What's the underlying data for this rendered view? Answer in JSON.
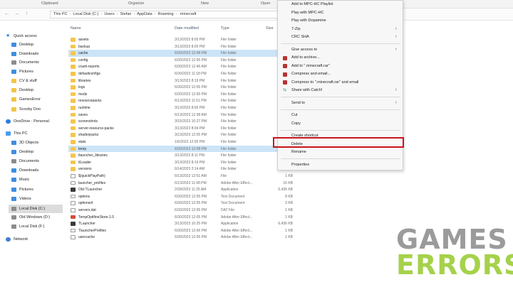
{
  "ribbon": {
    "tabs": [
      "Clipboard",
      "Organize",
      "New",
      "Open"
    ]
  },
  "address": {
    "segments": [
      "This PC",
      "Local Disk (C:)",
      "Users",
      "Stefan",
      "AppData",
      "Roaming",
      ".minecraft"
    ]
  },
  "sidebar": {
    "items": [
      {
        "label": "Quick access",
        "icon": "star-icon",
        "kind": "star"
      },
      {
        "label": "Desktop",
        "icon": "desktop-icon",
        "kind": "blue"
      },
      {
        "label": "Downloads",
        "icon": "downloads-icon",
        "kind": "blue"
      },
      {
        "label": "Documents",
        "icon": "documents-icon",
        "kind": "gray"
      },
      {
        "label": "Pictures",
        "icon": "pictures-icon",
        "kind": "blue"
      },
      {
        "label": "CV & stuff",
        "icon": "folder-icon",
        "kind": "yellow"
      },
      {
        "label": "Desktop",
        "icon": "folder-icon",
        "kind": "yellow"
      },
      {
        "label": "GamesError",
        "icon": "folder-icon",
        "kind": "yellow"
      },
      {
        "label": "Scooby Doo",
        "icon": "folder-icon",
        "kind": "yellow"
      },
      {
        "label": "OneDrive - Personal",
        "icon": "cloud-icon",
        "kind": "cloud"
      },
      {
        "label": "This PC",
        "icon": "computer-icon",
        "kind": "pc"
      },
      {
        "label": "3D Objects",
        "icon": "cube-icon",
        "kind": "blue"
      },
      {
        "label": "Desktop",
        "icon": "desktop-icon",
        "kind": "blue"
      },
      {
        "label": "Documents",
        "icon": "documents-icon",
        "kind": "gray"
      },
      {
        "label": "Downloads",
        "icon": "downloads-icon",
        "kind": "blue"
      },
      {
        "label": "Music",
        "icon": "music-icon",
        "kind": "blue"
      },
      {
        "label": "Pictures",
        "icon": "pictures-icon",
        "kind": "blue"
      },
      {
        "label": "Videos",
        "icon": "videos-icon",
        "kind": "blue"
      },
      {
        "label": "Local Disk (C:)",
        "icon": "drive-icon",
        "kind": "gray"
      },
      {
        "label": "Old Windows (D:)",
        "icon": "drive-icon",
        "kind": "gray"
      },
      {
        "label": "Local Disk (F:)",
        "icon": "drive-icon",
        "kind": "gray"
      },
      {
        "label": "Network",
        "icon": "network-icon",
        "kind": "net"
      }
    ],
    "selected_index": 18
  },
  "list": {
    "headers": {
      "name": "Name",
      "date": "Date modified",
      "type": "Type",
      "size": "Size"
    },
    "rows": [
      {
        "name": "assets",
        "date": "3/13/2023 8:05 PM",
        "type": "File folder",
        "size": "",
        "kind": "folder"
      },
      {
        "name": "backup",
        "date": "3/13/2023 8:05 PM",
        "type": "File folder",
        "size": "",
        "kind": "folder"
      },
      {
        "name": "cache",
        "date": "6/30/2023 12:08 PM",
        "type": "File folder",
        "size": "",
        "kind": "folder",
        "highlight": true
      },
      {
        "name": "config",
        "date": "6/30/2023 12:05 PM",
        "type": "File folder",
        "size": "",
        "kind": "folder"
      },
      {
        "name": "crash-reports",
        "date": "6/30/2023 12:46 AM",
        "type": "File folder",
        "size": "",
        "kind": "folder"
      },
      {
        "name": "defaultconfigs",
        "date": "6/30/2023 11:18 PM",
        "type": "File folder",
        "size": "",
        "kind": "folder"
      },
      {
        "name": "libraries",
        "date": "3/13/2023 8:19 PM",
        "type": "File folder",
        "size": "",
        "kind": "folder"
      },
      {
        "name": "logs",
        "date": "6/30/2023 12:05 PM",
        "type": "File folder",
        "size": "",
        "kind": "folder"
      },
      {
        "name": "mods",
        "date": "6/30/2023 12:05 PM",
        "type": "File folder",
        "size": "",
        "kind": "folder"
      },
      {
        "name": "resourcepacks",
        "date": "6/13/2023 11:51 PM",
        "type": "File folder",
        "size": "",
        "kind": "folder"
      },
      {
        "name": "runtime",
        "date": "3/13/2023 8:06 PM",
        "type": "File folder",
        "size": "",
        "kind": "folder"
      },
      {
        "name": "saves",
        "date": "6/13/2023 12:38 AM",
        "type": "File folder",
        "size": "",
        "kind": "folder"
      },
      {
        "name": "screenshots",
        "date": "3/15/2023 10:27 PM",
        "type": "File folder",
        "size": "",
        "kind": "folder"
      },
      {
        "name": "server-resource-packs",
        "date": "3/13/2023 8:04 PM",
        "type": "File folder",
        "size": "",
        "kind": "folder"
      },
      {
        "name": "shaderpacks",
        "date": "3/13/2023 12:05 PM",
        "type": "File folder",
        "size": "",
        "kind": "folder"
      },
      {
        "name": "stats",
        "date": "1/6/2023 12:05 PM",
        "type": "File folder",
        "size": "",
        "kind": "folder"
      },
      {
        "name": "temp",
        "date": "6/30/2023 12:08 PM",
        "type": "File folder",
        "size": "",
        "kind": "folder",
        "highlight": true
      },
      {
        "name": "tlauncher_libraries",
        "date": "3/13/2023 8:11 PM",
        "type": "File folder",
        "size": "",
        "kind": "folder"
      },
      {
        "name": "tlLoader",
        "date": "3/13/2023 8:19 PM",
        "type": "File folder",
        "size": "",
        "kind": "folder"
      },
      {
        "name": "versions",
        "date": "6/14/2023 2:14 AM",
        "type": "File folder",
        "size": "",
        "kind": "folder"
      },
      {
        "name": "$(quickPlayPath)",
        "date": "6/13/2023 12:51 AM",
        "type": "File",
        "size": "1 KB",
        "kind": "file"
      },
      {
        "name": "launcher_profiles",
        "date": "6/13/2023 11:08 PM",
        "type": "Adobe After Effect...",
        "size": "16 KB",
        "kind": "file"
      },
      {
        "name": "Old-TLauncher",
        "date": "2/28/2023 11:25 AM",
        "type": "Application",
        "size": "6,436 KB",
        "kind": "app"
      },
      {
        "name": "options",
        "date": "6/30/2023 12:05 PM",
        "type": "Text Document",
        "size": "8 KB",
        "kind": "file"
      },
      {
        "name": "optionsof",
        "date": "6/30/2023 12:05 PM",
        "type": "Text Document",
        "size": "3 KB",
        "kind": "file"
      },
      {
        "name": "servers.dat",
        "date": "6/30/2023 12:05 PM",
        "type": "DAT File",
        "size": "1 KB",
        "kind": "file"
      },
      {
        "name": "TempOptifineStore-1.0",
        "date": "6/30/2023 12:05 PM",
        "type": "Adobe After Effect...",
        "size": "1 KB",
        "kind": "pdf"
      },
      {
        "name": "TLauncher",
        "date": "3/13/2023 10:25 PM",
        "type": "Application",
        "size": "6,436 KB",
        "kind": "app"
      },
      {
        "name": "TlauncherProfiles",
        "date": "6/30/2023 12:06 PM",
        "type": "Adobe After Effect...",
        "size": "1 KB",
        "kind": "file"
      },
      {
        "name": "usercache",
        "date": "6/30/2023 12:05 PM",
        "type": "Adobe After Effect...",
        "size": "1 KB",
        "kind": "file"
      }
    ]
  },
  "context_menu": {
    "items": [
      {
        "label": "Add to MPC-HC Playlist",
        "icon": "",
        "submenu": false
      },
      {
        "label": "Play with MPC-HC",
        "icon": "",
        "submenu": false
      },
      {
        "label": "Play with Dopamine",
        "icon": "",
        "submenu": false
      },
      {
        "label": "7-Zip",
        "icon": "",
        "submenu": true
      },
      {
        "label": "CRC SHA",
        "icon": "",
        "submenu": true
      },
      {
        "sep": true
      },
      {
        "label": "Give access to",
        "icon": "",
        "submenu": true
      },
      {
        "label": "Add to archive...",
        "icon": "winrar-icon",
        "submenu": false
      },
      {
        "label": "Add to \".minecraft.rar\"",
        "icon": "winrar-icon",
        "submenu": false
      },
      {
        "label": "Compress and email...",
        "icon": "winrar-icon",
        "submenu": false
      },
      {
        "label": "Compress to \".minecraft.rar\" and email",
        "icon": "winrar-icon",
        "submenu": false
      },
      {
        "label": "Share with Catch!",
        "icon": "share-icon",
        "submenu": true
      },
      {
        "sep": true
      },
      {
        "label": "Send to",
        "icon": "",
        "submenu": true
      },
      {
        "sep": true
      },
      {
        "label": "Cut",
        "icon": "",
        "submenu": false
      },
      {
        "label": "Copy",
        "icon": "",
        "submenu": false
      },
      {
        "sep": true
      },
      {
        "label": "Create shortcut",
        "icon": "",
        "submenu": false
      },
      {
        "label": "Delete",
        "icon": "",
        "submenu": false
      },
      {
        "label": "Rename",
        "icon": "",
        "submenu": false
      },
      {
        "sep": true
      },
      {
        "label": "Properties",
        "icon": "",
        "submenu": false
      }
    ],
    "highlighted_label": "Delete",
    "highlight_color": "#c8141c"
  },
  "watermark": {
    "line1": "GAMES",
    "line2": "ERRORS",
    "color1": "#9b9b9b",
    "color2": "#a5d24a"
  },
  "icons": {
    "back": "←",
    "forward": "→",
    "up": "↑",
    "submenu_arrow": "›",
    "share": "⇆",
    "star": "★"
  }
}
